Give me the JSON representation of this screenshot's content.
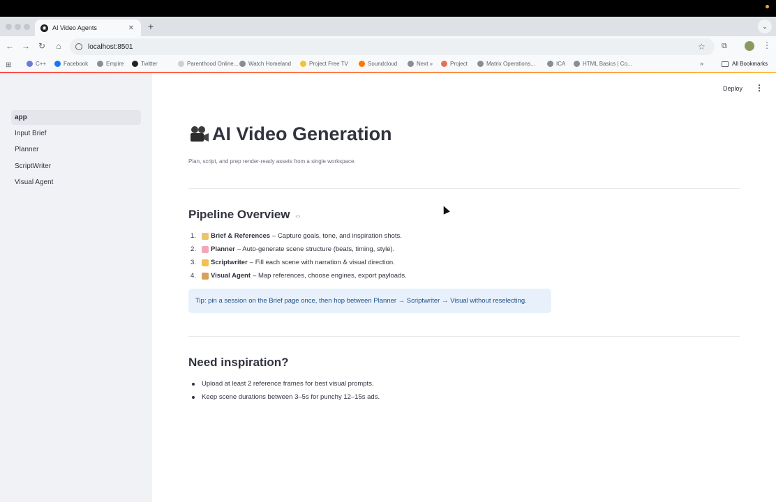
{
  "browser": {
    "tab_title": "AI Video Agents",
    "tab_close": "✕",
    "new_tab": "+",
    "url": "localhost:8501",
    "bookmarks": [
      {
        "label": "C++",
        "color": "#6b7bd6"
      },
      {
        "label": "Facebook",
        "color": "#1877f2"
      },
      {
        "label": "Empire",
        "color": "#8a8d96"
      },
      {
        "label": "Twitter",
        "color": "#222222"
      },
      {
        "label": "Parenthood Online...",
        "color": "#d0d0d0"
      },
      {
        "label": "Watch Homeland",
        "color": "#8a8d96"
      },
      {
        "label": "Project Free TV",
        "color": "#f4c430"
      },
      {
        "label": "Soundcloud",
        "color": "#ff7700"
      },
      {
        "label": "Next »",
        "color": "#8a8d96"
      },
      {
        "label": "Project",
        "color": "#e2725b"
      },
      {
        "label": "Matrix Operations...",
        "color": "#8a8d96"
      },
      {
        "label": "ICA",
        "color": "#8a8d96"
      },
      {
        "label": "HTML Basics | Co...",
        "color": "#8a8d96"
      }
    ],
    "bookmarks_more": "»",
    "all_bookmarks": "All Bookmarks"
  },
  "sidebar": {
    "items": [
      {
        "label": "app",
        "active": true
      },
      {
        "label": "Input Brief",
        "active": false
      },
      {
        "label": "Planner",
        "active": false
      },
      {
        "label": "ScriptWriter",
        "active": false
      },
      {
        "label": "Visual Agent",
        "active": false
      }
    ]
  },
  "header": {
    "deploy_label": "Deploy",
    "menu_icon": "⋮"
  },
  "main": {
    "title": "AI Video Generation",
    "subtitle": "Plan, script, and prep render-ready assets from a single workspace.",
    "pipeline": {
      "heading": "Pipeline Overview",
      "link_icon": "⇔",
      "steps": [
        {
          "num": "1.",
          "emoji_color": "#e9c46a",
          "bold": "Brief & References",
          "text": "– Capture goals, tone, and inspiration shots."
        },
        {
          "num": "2.",
          "emoji_color": "#f4a6b7",
          "bold": "Planner",
          "text": "– Auto-generate scene structure (beats, timing, style)."
        },
        {
          "num": "3.",
          "emoji_color": "#f2c14e",
          "bold": "Scriptwriter",
          "text": "– Fill each scene with narration & visual direction."
        },
        {
          "num": "4.",
          "emoji_color": "#d9a05b",
          "bold": "Visual Agent",
          "text": "– Map references, choose engines, export payloads."
        }
      ],
      "tip": "Tip: pin a session on the Brief page once, then hop between Planner → Scriptwriter → Visual without reselecting."
    },
    "inspiration": {
      "heading": "Need inspiration?",
      "items": [
        "Upload at least 2 reference frames for best visual prompts.",
        "Keep scene durations between 3–5s for punchy 12–15s ads."
      ]
    }
  }
}
